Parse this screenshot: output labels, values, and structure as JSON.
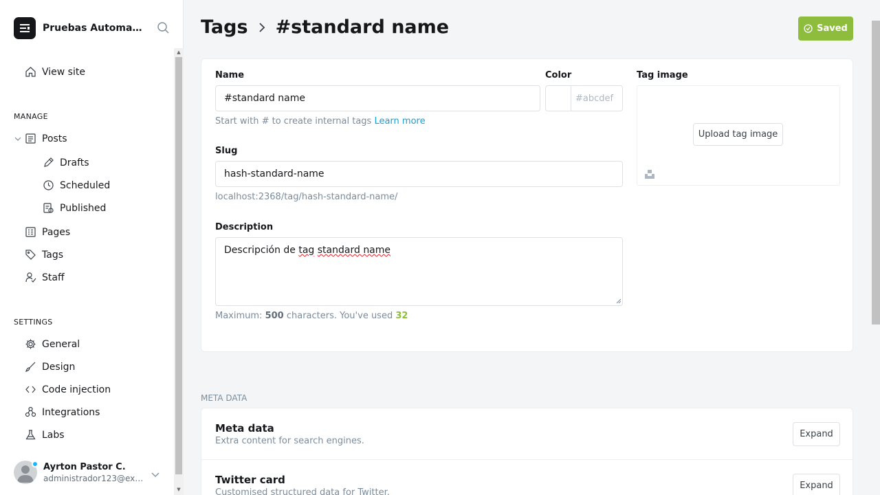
{
  "sidebar": {
    "site_name": "Pruebas Automati...",
    "view_site": "View site",
    "manage_title": "MANAGE",
    "posts": "Posts",
    "drafts": "Drafts",
    "scheduled": "Scheduled",
    "published": "Published",
    "pages": "Pages",
    "tags": "Tags",
    "staff": "Staff",
    "settings_title": "SETTINGS",
    "general": "General",
    "design": "Design",
    "code_injection": "Code injection",
    "integrations": "Integrations",
    "labs": "Labs",
    "user_name": "Ayrton Pastor C.",
    "user_email": "administrador123@exa..."
  },
  "header": {
    "breadcrumb_parent": "Tags",
    "breadcrumb_current": "#standard name",
    "saved_label": "Saved"
  },
  "form": {
    "name_label": "Name",
    "name_value": "#standard name",
    "name_hint": "Start with # to create internal tags",
    "name_hint_link": "Learn more",
    "color_label": "Color",
    "color_placeholder": "#abcdef",
    "tag_image_label": "Tag image",
    "upload_label": "Upload tag image",
    "slug_label": "Slug",
    "slug_value": "hash-standard-name",
    "slug_url": "localhost:2368/tag/hash-standard-name/",
    "description_label": "Description",
    "description_prefix": "Descripción de ",
    "description_word1": "tag",
    "description_space": " ",
    "description_word2": "standard name",
    "desc_hint_prefix": "Maximum: ",
    "desc_hint_max": "500",
    "desc_hint_middle": " characters. You've used ",
    "desc_hint_used": "32"
  },
  "meta": {
    "section_title": "META DATA",
    "cards": [
      {
        "title": "Meta data",
        "desc": "Extra content for search engines.",
        "button": "Expand"
      },
      {
        "title": "Twitter card",
        "desc": "Customised structured data for Twitter.",
        "button": "Expand"
      }
    ]
  },
  "colors": {
    "accent_green": "#8ebc3c",
    "link_blue": "#14a0d8",
    "status_dot": "#14b8ff"
  }
}
